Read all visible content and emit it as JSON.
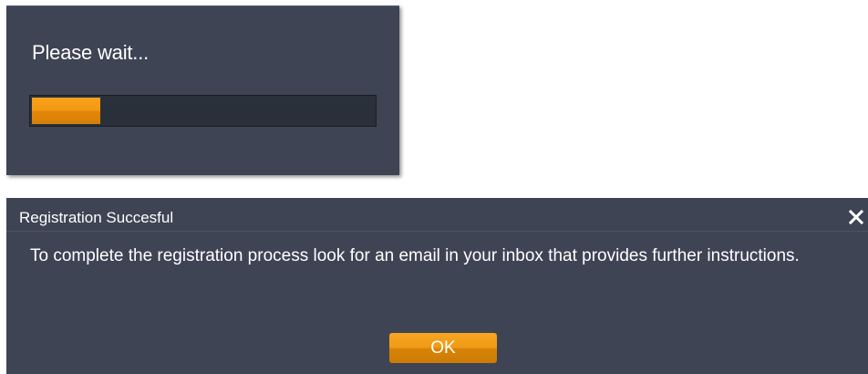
{
  "wait_dialog": {
    "message": "Please wait...",
    "progress_percent": 20
  },
  "registration_dialog": {
    "title": "Registration Succesful",
    "message": "To complete the registration process look for an email in your inbox that provides further instructions.",
    "ok_label": "OK",
    "close_icon": "close-icon"
  },
  "colors": {
    "dialog_bg": "#3e4453",
    "progress_track": "#2a3039",
    "accent_orange": "#f29813",
    "text": "#ffffff"
  }
}
